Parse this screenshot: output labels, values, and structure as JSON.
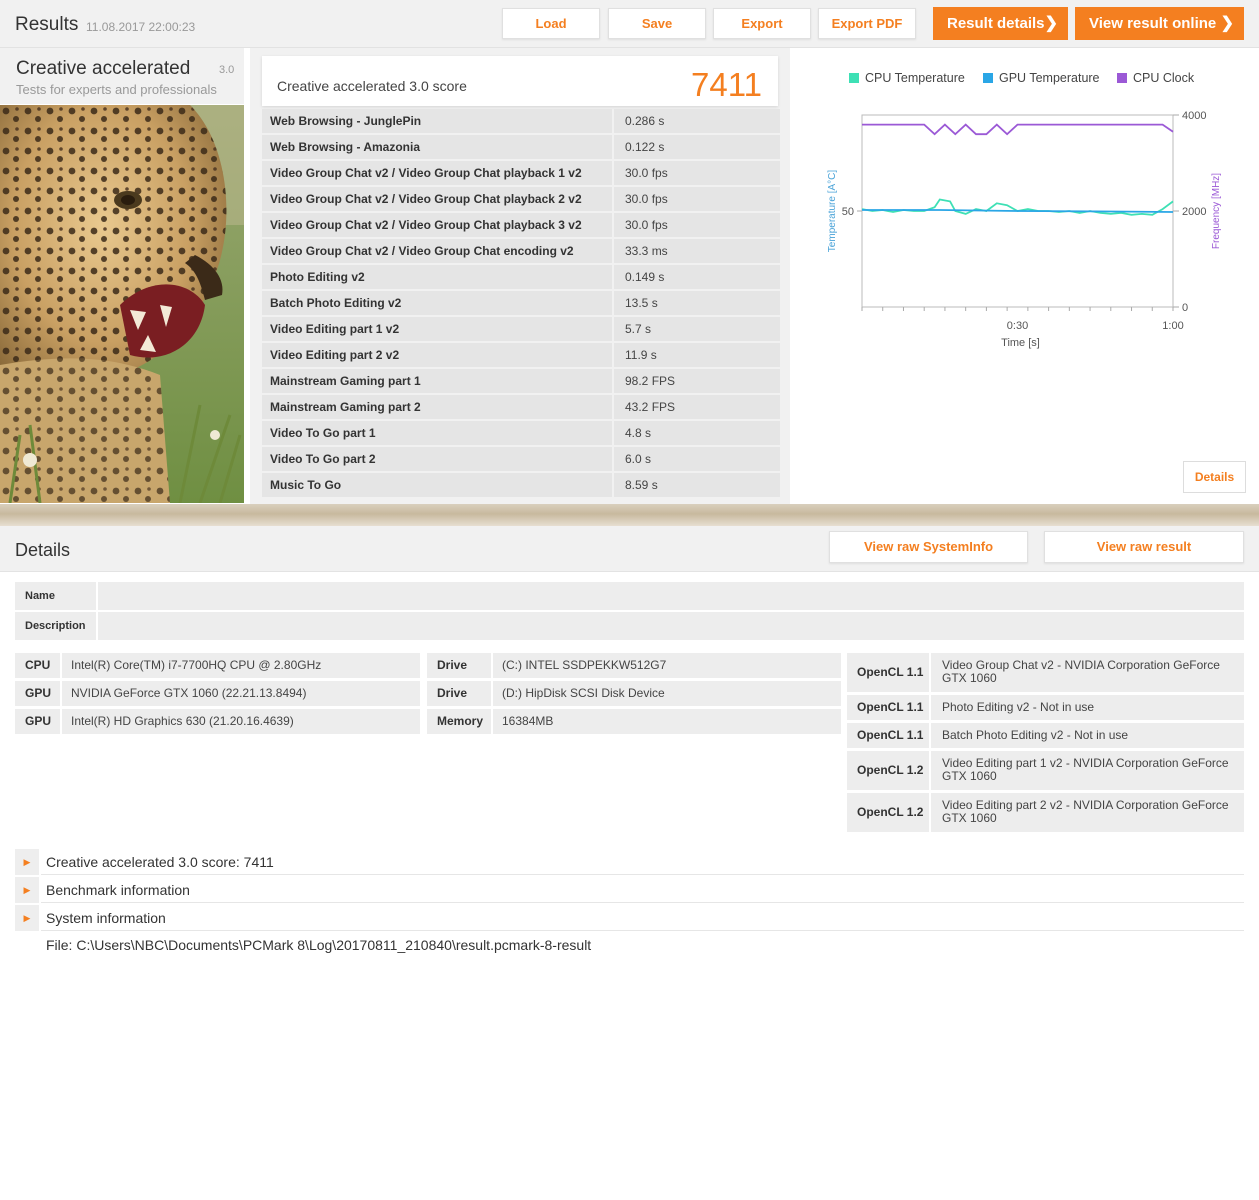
{
  "header": {
    "title": "Results",
    "date": "11.08.2017 22:00:23",
    "buttons": {
      "load": "Load",
      "save": "Save",
      "export": "Export",
      "export_pdf": "Export PDF"
    },
    "result_details": "Result details",
    "view_online": "View result online"
  },
  "benchmark": {
    "name": "Creative accelerated",
    "version": "3.0",
    "subtitle": "Tests for experts and professionals"
  },
  "score": {
    "label": "Creative accelerated 3.0 score",
    "value": "7411"
  },
  "results": [
    {
      "name": "Web Browsing - JunglePin",
      "value": "0.286 s"
    },
    {
      "name": "Web Browsing - Amazonia",
      "value": "0.122 s"
    },
    {
      "name": "Video Group Chat v2 / Video Group Chat playback 1 v2",
      "value": "30.0 fps"
    },
    {
      "name": "Video Group Chat v2 / Video Group Chat playback 2 v2",
      "value": "30.0 fps"
    },
    {
      "name": "Video Group Chat v2 / Video Group Chat playback 3 v2",
      "value": "30.0 fps"
    },
    {
      "name": "Video Group Chat v2 / Video Group Chat encoding v2",
      "value": "33.3 ms"
    },
    {
      "name": "Photo Editing v2",
      "value": "0.149 s"
    },
    {
      "name": "Batch Photo Editing v2",
      "value": "13.5 s"
    },
    {
      "name": "Video Editing part 1 v2",
      "value": "5.7 s"
    },
    {
      "name": "Video Editing part 2 v2",
      "value": "11.9 s"
    },
    {
      "name": "Mainstream Gaming part 1",
      "value": "98.2 FPS"
    },
    {
      "name": "Mainstream Gaming part 2",
      "value": "43.2 FPS"
    },
    {
      "name": "Video To Go part 1",
      "value": "4.8 s"
    },
    {
      "name": "Video To Go part 2",
      "value": "6.0 s"
    },
    {
      "name": "Music To Go",
      "value": "8.59 s"
    }
  ],
  "chart_data": {
    "type": "line",
    "legend": [
      {
        "name": "CPU Temperature",
        "color": "#3ee0b5"
      },
      {
        "name": "GPU Temperature",
        "color": "#2aa6e6"
      },
      {
        "name": "CPU Clock",
        "color": "#9b59d6"
      }
    ],
    "xlabel": "Time [s]",
    "ylabel_left": "Temperature [A°C]",
    "ylabel_right": "Frequency [MHz]",
    "x_ticks": [
      "0:30",
      "1:00"
    ],
    "y_left_ticks": [
      "50"
    ],
    "y_right_ticks": [
      "4000",
      "2000",
      "0"
    ],
    "xlim": [
      0,
      60
    ],
    "ylim_left": [
      0,
      100
    ],
    "ylim_right": [
      0,
      4000
    ],
    "series": [
      {
        "name": "CPU Temperature",
        "axis": "left",
        "points": [
          [
            0,
            51
          ],
          [
            2,
            50
          ],
          [
            4,
            50.5
          ],
          [
            6,
            49.5
          ],
          [
            8,
            50.5
          ],
          [
            10,
            50
          ],
          [
            12,
            50
          ],
          [
            14,
            52
          ],
          [
            15,
            56
          ],
          [
            17,
            55
          ],
          [
            18,
            50
          ],
          [
            20,
            48.5
          ],
          [
            22,
            51
          ],
          [
            24,
            50
          ],
          [
            26,
            54
          ],
          [
            28,
            53
          ],
          [
            30,
            50
          ],
          [
            32,
            51
          ],
          [
            34,
            50
          ],
          [
            36,
            50
          ],
          [
            38,
            49.5
          ],
          [
            40,
            50
          ],
          [
            42,
            49
          ],
          [
            44,
            50
          ],
          [
            46,
            49
          ],
          [
            48,
            48.5
          ],
          [
            50,
            49
          ],
          [
            52,
            48
          ],
          [
            54,
            48.5
          ],
          [
            56,
            48
          ],
          [
            58,
            51
          ],
          [
            60,
            55
          ]
        ]
      },
      {
        "name": "GPU Temperature",
        "axis": "left",
        "points": [
          [
            0,
            50.5
          ],
          [
            15,
            50.5
          ],
          [
            30,
            50
          ],
          [
            45,
            49.8
          ],
          [
            60,
            49.5
          ]
        ]
      },
      {
        "name": "CPU Clock",
        "axis": "right",
        "points": [
          [
            0,
            3800
          ],
          [
            12,
            3800
          ],
          [
            14,
            3600
          ],
          [
            16,
            3800
          ],
          [
            18,
            3600
          ],
          [
            20,
            3800
          ],
          [
            22,
            3600
          ],
          [
            24,
            3600
          ],
          [
            26,
            3800
          ],
          [
            28,
            3600
          ],
          [
            30,
            3800
          ],
          [
            45,
            3800
          ],
          [
            58,
            3800
          ],
          [
            60,
            3650
          ]
        ]
      }
    ]
  },
  "chart_details_button": "Details",
  "details": {
    "title": "Details",
    "view_sysinfo": "View raw SystemInfo",
    "view_raw_result": "View raw result",
    "name_label": "Name",
    "description_label": "Description",
    "col1": [
      {
        "key": "CPU",
        "value": "Intel(R) Core(TM) i7-7700HQ CPU @ 2.80GHz"
      },
      {
        "key": "GPU",
        "value": "NVIDIA GeForce GTX 1060 (22.21.13.8494)"
      },
      {
        "key": "GPU",
        "value": "Intel(R) HD Graphics 630 (21.20.16.4639)"
      }
    ],
    "col2": [
      {
        "key": "Drive",
        "value": "(C:) INTEL SSDPEKKW512G7"
      },
      {
        "key": "Drive",
        "value": "(D:) HipDisk  SCSI Disk Device"
      },
      {
        "key": "Memory",
        "value": "16384MB"
      }
    ],
    "opencl": [
      {
        "key": "OpenCL 1.1",
        "value": "Video Group Chat v2 - NVIDIA Corporation GeForce GTX 1060"
      },
      {
        "key": "OpenCL 1.1",
        "value": "Photo Editing v2 - Not in use"
      },
      {
        "key": "OpenCL 1.1",
        "value": "Batch Photo Editing v2 - Not in use"
      },
      {
        "key": "OpenCL 1.2",
        "value": "Video Editing part 1 v2 - NVIDIA Corporation GeForce GTX 1060"
      },
      {
        "key": "OpenCL 1.2",
        "value": "Video Editing part 2 v2 - NVIDIA Corporation GeForce GTX 1060"
      }
    ],
    "accordion": [
      "Creative accelerated 3.0 score: 7411",
      "Benchmark information",
      "System information"
    ],
    "file": "File: C:\\Users\\NBC\\Documents\\PCMark 8\\Log\\20170811_210840\\result.pcmark-8-result"
  }
}
